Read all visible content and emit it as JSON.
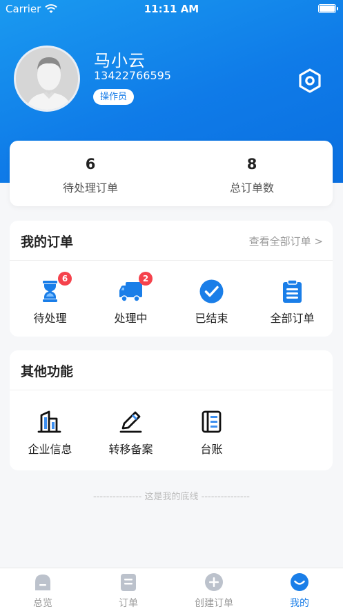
{
  "status_bar": {
    "carrier": "Carrier",
    "time": "11:11 AM"
  },
  "profile": {
    "name": "马小云",
    "phone": "13422766595",
    "role": "操作员"
  },
  "stats": [
    {
      "value": "6",
      "label": "待处理订单"
    },
    {
      "value": "8",
      "label": "总订单数"
    }
  ],
  "my_orders": {
    "title": "我的订单",
    "view_all": "查看全部订单 >",
    "items": [
      {
        "label": "待处理",
        "badge": "6",
        "icon": "hourglass-icon"
      },
      {
        "label": "处理中",
        "badge": "2",
        "icon": "truck-icon"
      },
      {
        "label": "已结束",
        "icon": "check-circle-icon"
      },
      {
        "label": "全部订单",
        "icon": "clipboard-icon"
      }
    ]
  },
  "other_functions": {
    "title": "其他功能",
    "items": [
      {
        "label": "企业信息",
        "icon": "building-icon"
      },
      {
        "label": "转移备案",
        "icon": "edit-pen-icon"
      },
      {
        "label": "台账",
        "icon": "ledger-book-icon"
      }
    ]
  },
  "footer_text": "--------------- 这是我的底线 ---------------",
  "tabs": [
    {
      "label": "总览",
      "icon": "overview-icon",
      "active": false
    },
    {
      "label": "订单",
      "icon": "order-doc-icon",
      "active": false
    },
    {
      "label": "创建订单",
      "icon": "plus-circle-icon",
      "active": false
    },
    {
      "label": "我的",
      "icon": "smile-user-icon",
      "active": true
    }
  ],
  "colors": {
    "brand_blue": "#1a7ee8",
    "badge_red": "#f5424c",
    "inactive_gray": "#999999"
  }
}
